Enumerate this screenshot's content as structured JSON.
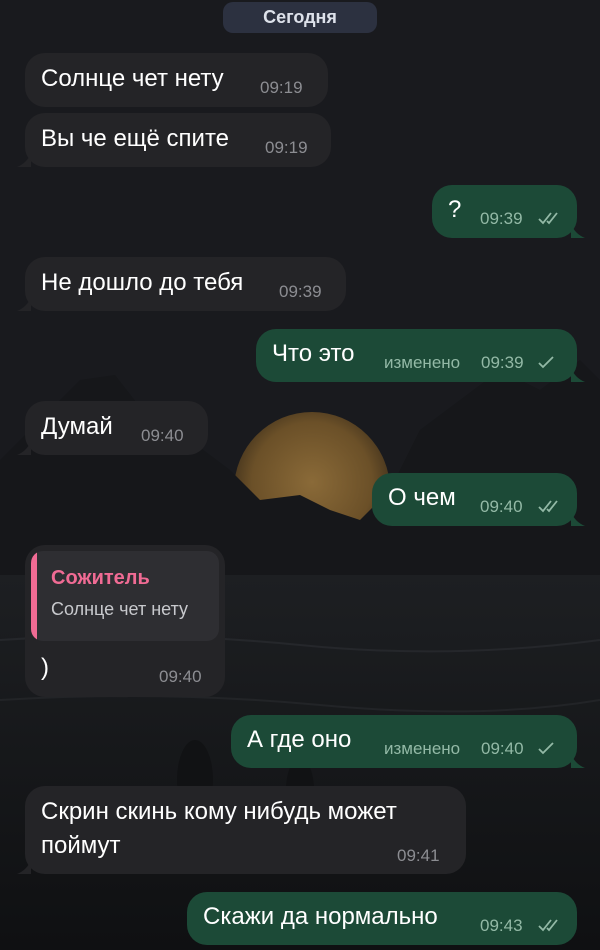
{
  "date_separator": "Сегодня",
  "messages": [
    {
      "text": "Солнце чет нету",
      "time": "09:19"
    },
    {
      "text": "Вы че ещё спите",
      "time": "09:19"
    },
    {
      "text": "?",
      "time": "09:39"
    },
    {
      "text": "Не дошло до тебя",
      "time": "09:39"
    },
    {
      "text": "Что это",
      "edited": "изменено",
      "time": "09:39"
    },
    {
      "text": "Думай",
      "time": "09:40"
    },
    {
      "text": "О чем",
      "time": "09:40"
    },
    {
      "reply_author": "Сожитель",
      "reply_text": "Солнце чет нету",
      "text": ")",
      "time": "09:40"
    },
    {
      "text": "А где оно",
      "edited": "изменено",
      "time": "09:40"
    },
    {
      "text_line1": "Скрин скинь кому нибудь может",
      "text_line2": "поймут",
      "time": "09:41"
    },
    {
      "text": "Скажи да нормально",
      "time": "09:43"
    }
  ],
  "icons": {
    "read": "double-check-icon",
    "sent": "single-check-icon"
  },
  "colors": {
    "incoming_bubble": "#242427",
    "outgoing_bubble": "#1c4a37",
    "reply_accent": "#f06b94",
    "date_pill": "#2c3140"
  }
}
